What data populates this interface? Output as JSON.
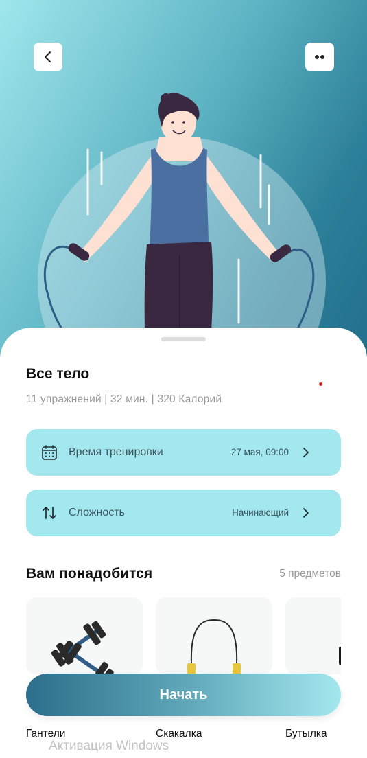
{
  "header": {
    "back_icon": "chevron-left-icon",
    "menu_icon": "two-dots-icon",
    "illustration": "man-jumping-rope-illustration"
  },
  "workout": {
    "title": "Все тело",
    "subtitle": "11 упражнений | 32 мин. | 320 Калорий"
  },
  "schedule": {
    "icon": "calendar-icon",
    "label": "Время тренировки",
    "value": "27 мая, 09:00"
  },
  "difficulty": {
    "icon": "sort-arrows-icon",
    "label": "Сложность",
    "value": "Начинающий"
  },
  "equipment": {
    "title": "Вам понадобится",
    "count": "5 предметов",
    "items": [
      {
        "label": "Гантели",
        "icon": "dumbbells-icon"
      },
      {
        "label": "Скакалка",
        "icon": "jump-rope-icon"
      },
      {
        "label": "Бутылка",
        "icon": "bottle-icon"
      }
    ]
  },
  "start_button": "Начать",
  "os_watermark": "Активация Windows",
  "colors": {
    "accent_card": "#a2e8ee",
    "hero_gradient_start": "#9fe7ec",
    "hero_gradient_end": "#236f8c",
    "button_gradient_start": "#2c6e8c",
    "button_gradient_end": "#a4e8ee"
  }
}
